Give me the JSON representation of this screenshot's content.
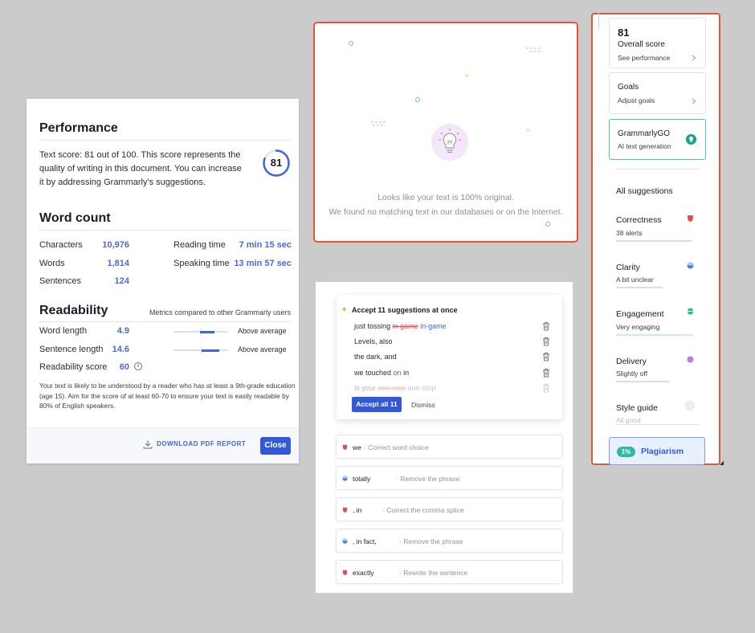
{
  "performance": {
    "title": "Performance",
    "description": "Text score: 81 out of 100. This score represents the quality of writing in this document. You can increase it by addressing Grammarly's suggestions.",
    "score": "81",
    "score_fraction": 0.81,
    "word_count_title": "Word count",
    "stats": [
      {
        "label": "Characters",
        "value": "10,976"
      },
      {
        "label": "Words",
        "value": "1,814"
      },
      {
        "label": "Sentences",
        "value": "124"
      }
    ],
    "times": [
      {
        "label": "Reading time",
        "value": "7 min 15 sec"
      },
      {
        "label": "Speaking time",
        "value": "13 min 57 sec"
      }
    ],
    "readability_title": "Readability",
    "readability_note": "Metrics compared to other Grammarly users",
    "readability": [
      {
        "label": "Word length",
        "value": "4.9",
        "result": "Above average"
      },
      {
        "label": "Sentence length",
        "value": "14.6",
        "result": "Above average"
      },
      {
        "label": "Readability score",
        "value": "60"
      }
    ],
    "footer_text": "Your text is likely to be understood by a reader who has at least a 9th-grade education (age 15). Aim for the score of at least 60-70 to ensure your text is easily readable by 80% of English speakers.",
    "download_label": "DOWNLOAD PDF REPORT",
    "close_label": "Close"
  },
  "originality": {
    "line1": "Looks like your text is 100% original.",
    "line2": "We found no matching text in our databases or on the Internet."
  },
  "accept_card": {
    "title": "Accept 11 suggestions at once",
    "accept_label": "Accept all 11",
    "dismiss_label": "Dismiss",
    "rows": [
      {
        "pre": "just tossing ",
        "del": "in game",
        "ins": " in-game",
        "post": ""
      },
      {
        "pre": "Levels, also",
        "del": "",
        "ins": "",
        "post": ""
      },
      {
        "pre": "the dark, and",
        "del": "",
        "ins": "",
        "post": ""
      },
      {
        "pre": "we touched ",
        "del": "",
        "ins": "on",
        "post": " in"
      },
      {
        "pre": "Is your ",
        "del": "one stop",
        "ins": " one-stop",
        "post": ""
      }
    ]
  },
  "suggestions": [
    {
      "word": "we",
      "hint": "Correct word choice",
      "kind": "correctness"
    },
    {
      "word": "totally",
      "hint": "Remove the phrase",
      "kind": "clarity"
    },
    {
      "word": ", in",
      "hint": "Correct the comma splice",
      "kind": "correctness"
    },
    {
      "word": ", in fact,",
      "hint": "Remove the phrase",
      "kind": "clarity"
    },
    {
      "word": "exactly",
      "hint": "Rewrite the sentence",
      "kind": "correctness"
    }
  ],
  "sidebar": {
    "score": "81",
    "score_label": "Overall score",
    "score_link": "See performance",
    "goals_label": "Goals",
    "goals_link": "Adjust goals",
    "go_label": "GrammarlyGO",
    "go_sub": "AI text generation",
    "all_suggestions": "All suggestions",
    "categories": [
      {
        "name": "Correctness",
        "sub": "38 alerts",
        "color": "#e14d4d"
      },
      {
        "name": "Clarity",
        "sub": "A bit unclear",
        "color": "#3f7fe0"
      },
      {
        "name": "Engagement",
        "sub": "Very engaging",
        "color": "#1fbf8f"
      },
      {
        "name": "Delivery",
        "sub": "Slightly off",
        "color": "#a060e0"
      },
      {
        "name": "Style guide",
        "sub": "All good",
        "color": "#c7cde0"
      }
    ],
    "plagiarism_pct": "1%",
    "plagiarism_label": "Plagiarism"
  },
  "colors": {
    "accent": "#3359d9",
    "highlight_border": "#e6543a"
  }
}
